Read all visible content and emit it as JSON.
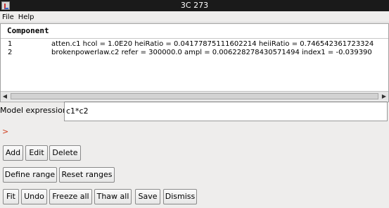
{
  "window": {
    "title": "3C 273"
  },
  "menu": {
    "file": "File",
    "help": "Help"
  },
  "table": {
    "header": "Component",
    "rows": [
      {
        "num": "1",
        "text": "atten.c1   hcol = 1.0E20 heiRatio = 0.04177875111602214 heiiRatio = 0.746542361723324"
      },
      {
        "num": "2",
        "text": "brokenpowerlaw.c2   refer = 300000.0 ampl = 0.006228278430571494 index1 = -0.039390"
      }
    ]
  },
  "expression": {
    "label": "Model expression",
    "value": "c1*c2"
  },
  "prompt": ">",
  "buttons": {
    "add": "Add",
    "edit": "Edit",
    "delete": "Delete",
    "define_range": "Define range",
    "reset_ranges": "Reset ranges",
    "fit": "Fit",
    "undo": "Undo",
    "freeze_all": "Freeze all",
    "thaw_all": "Thaw all",
    "save": "Save",
    "dismiss": "Dismiss"
  },
  "colors": {
    "titlebar": "#1a1a1a",
    "prompt": "#d04020"
  }
}
